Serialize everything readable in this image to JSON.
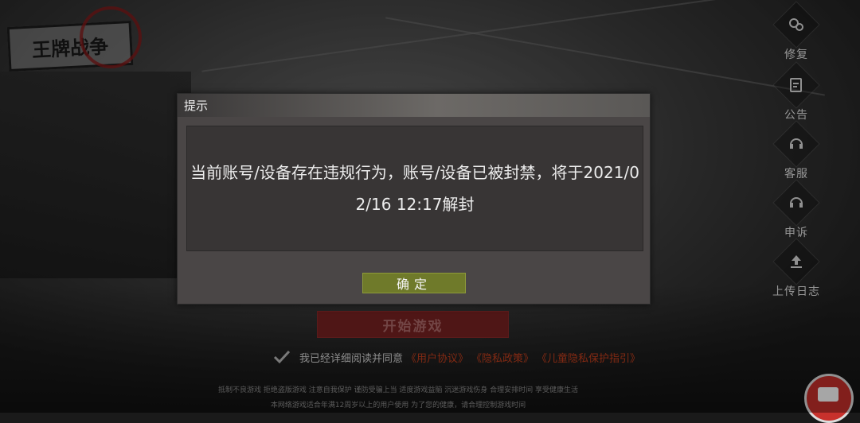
{
  "logo": {
    "text": "王牌战争"
  },
  "side_menu": [
    {
      "label": "修复",
      "icon": "gears-icon"
    },
    {
      "label": "公告",
      "icon": "clipboard-icon"
    },
    {
      "label": "客服",
      "icon": "headset-icon"
    },
    {
      "label": "申诉",
      "icon": "headset-icon"
    },
    {
      "label": "上传日志",
      "icon": "upload-icon"
    }
  ],
  "start_button": {
    "label": "开始游戏"
  },
  "agreement": {
    "text": "我已经详细阅读并同意",
    "links": [
      "《用户协议》",
      "《隐私政策》",
      "《儿童隐私保护指引》"
    ]
  },
  "notices": {
    "line1": "抵制不良游戏 拒绝盗版游戏 注意自我保护 谨防受骗上当 适度游戏益脑 沉迷游戏伤身 合理安排时间 享受健康生活",
    "line2": "本网络游戏适合年满12周岁以上的用户使用 为了您的健康，请合理控制游戏时间"
  },
  "dialog": {
    "title": "提示",
    "message": "当前账号/设备存在违规行为，账号/设备已被封禁，将于2021/02/16 12:17解封",
    "confirm_label": "确定"
  },
  "colors": {
    "confirm_button": "#6f7a2a",
    "start_button": "#7a2222",
    "link": "#c8401e"
  }
}
